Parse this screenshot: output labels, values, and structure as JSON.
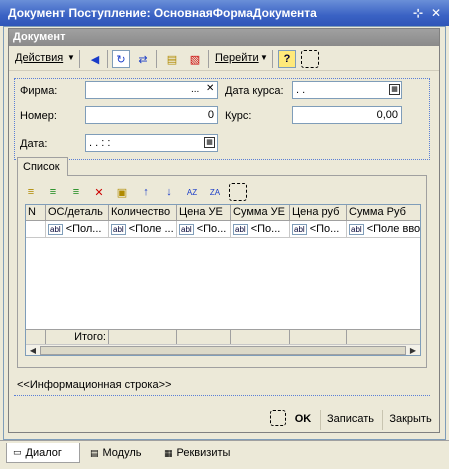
{
  "window": {
    "title": "Документ Поступление: ОсновнаяФормаДокумента"
  },
  "form": {
    "title": "Документ"
  },
  "toolbar": {
    "actions_label": "Действия",
    "goto_label": "Перейти",
    "help_icon": "?"
  },
  "fields": {
    "firma_label": "Фирма:",
    "firma_value": "",
    "nomer_label": "Номер:",
    "nomer_value": "0",
    "data_label": "Дата:",
    "data_value": ". .   : :",
    "data_kursa_label": "Дата курса:",
    "data_kursa_value": ". .",
    "kurs_label": "Курс:",
    "kurs_value": "0,00",
    "ellipsis": "...",
    "clear_x": "✕"
  },
  "tabs": {
    "list_label": "Список"
  },
  "grid": {
    "columns": [
      "N",
      "ОС/деталь",
      "Количество",
      "Цена УЕ",
      "Сумма УЕ",
      "Цена руб",
      "Сумма Руб"
    ],
    "row": [
      "",
      "<Пол...",
      "<Поле ...",
      "<По...",
      "<По...",
      "<По...",
      "<Поле вво"
    ],
    "abl": "abl",
    "footer_label": "Итого:"
  },
  "info_line": "<<Информационная строка>>",
  "buttons": {
    "ok": "OK",
    "save": "Записать",
    "close": "Закрыть"
  },
  "bottom_tabs": {
    "dialog": "Диалог",
    "module": "Модуль",
    "props": "Реквизиты"
  }
}
